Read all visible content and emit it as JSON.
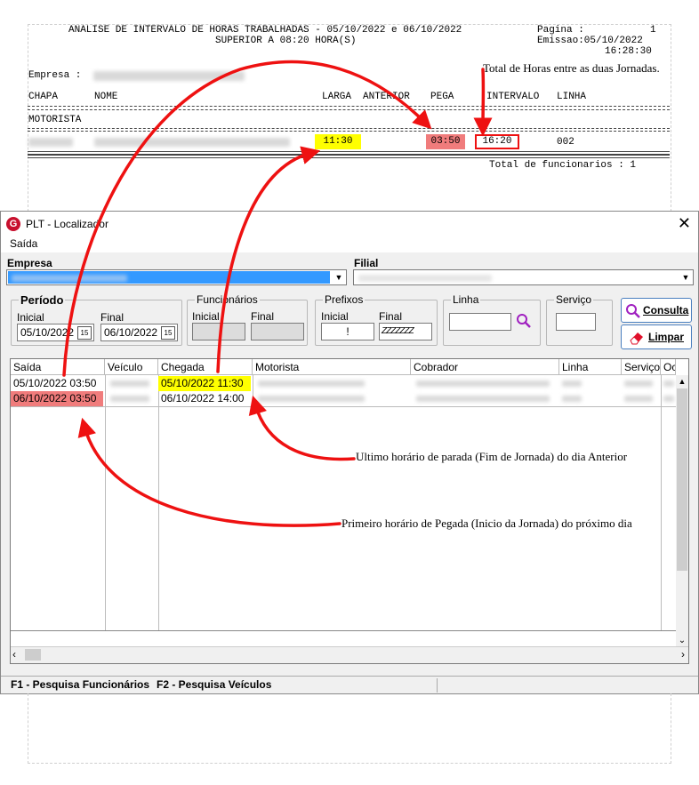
{
  "report": {
    "title_line1": "ANALISE DE INTERVALO DE HORAS TRABALHADAS - 05/10/2022 e 06/10/2022",
    "title_line2": "SUPERIOR A 08:20 HORA(S)",
    "pagina_label": "Pagina :",
    "pagina_value": "1",
    "emissao_label": "Emissao:05/10/2022",
    "emissao_time": "16:28:30",
    "empresa_label": "Empresa :",
    "headers": {
      "chapa": "CHAPA",
      "nome": "NOME",
      "larga": "LARGA",
      "anterior": "ANTERIOR",
      "pega": "PEGA",
      "intervalo": "INTERVALO",
      "linha": "LINHA"
    },
    "section": "MOTORISTA",
    "row": {
      "larga": "11:30",
      "pega": "03:50",
      "intervalo": "16:20",
      "linha": "002"
    },
    "total": "Total de funcionarios : 1"
  },
  "annotations": {
    "top": "Total de Horas entre as duas Jornadas.",
    "middle": "Ultimo horário de parada (Fim de Jornada) do dia Anterior",
    "bottom": "Primeiro horário de Pegada (Inicio da Jornada) do próximo dia"
  },
  "window": {
    "title": "PLT - Localizador",
    "menu_saida": "Saída",
    "empresa_label": "Empresa",
    "filial_label": "Filial",
    "periodo": {
      "title": "Período",
      "inicial_label": "Inicial",
      "final_label": "Final",
      "inicial_value": "05/10/2022",
      "final_value": "06/10/2022"
    },
    "funcionarios": {
      "title": "Funcionários",
      "inicial_label": "Inicial",
      "final_label": "Final"
    },
    "prefixos": {
      "title": "Prefixos",
      "inicial_label": "Inicial",
      "final_label": "Final",
      "inicial_value": "!",
      "final_value": "ZZZZZZZ"
    },
    "linha_title": "Linha",
    "servico_title": "Serviço",
    "consulta_label": "Consulta",
    "limpar_label": "Limpar",
    "columns": [
      "Saída",
      "Veículo",
      "Chegada",
      "Motorista",
      "Cobrador",
      "Linha",
      "Serviço",
      "Oc"
    ],
    "rows": [
      {
        "saida": "05/10/2022 03:50",
        "chegada": "05/10/2022 11:30"
      },
      {
        "saida": "06/10/2022 03:50",
        "chegada": "06/10/2022 14:00"
      }
    ],
    "status_f1": "F1 - Pesquisa Funcionários",
    "status_f2": "F2 - Pesquisa Veículos"
  },
  "colors": {
    "highlight_yellow": "#ffff00",
    "highlight_red": "#f07c7c",
    "arrow_red": "#ee1111",
    "selection_blue": "#3399ff"
  }
}
